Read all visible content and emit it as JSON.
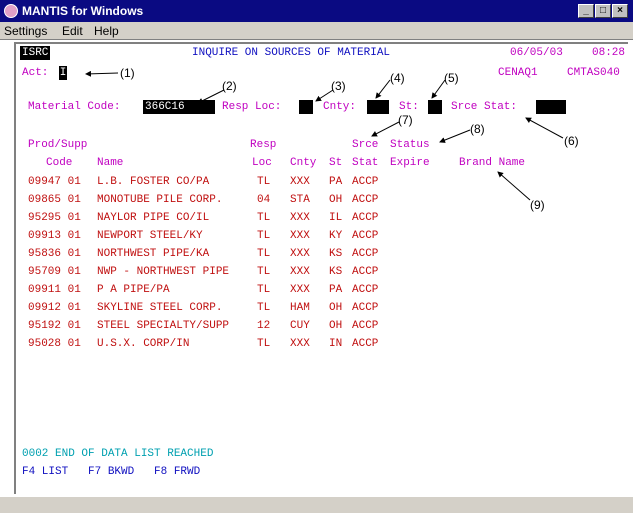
{
  "window": {
    "title": "MANTIS for Windows"
  },
  "menu": {
    "items": [
      "Settings",
      "Edit",
      "Help"
    ]
  },
  "header": {
    "screen_id": "ISRC",
    "title": "INQUIRE ON SOURCES OF MATERIAL",
    "date": "06/05/03",
    "time": "08:28",
    "user_id": "CENAQ1",
    "system_id": "CMTAS040"
  },
  "act": {
    "label": "Act:",
    "value": "I"
  },
  "form": {
    "material_code_label": "Material Code:",
    "material_code_value": "366C16",
    "resp_loc_label": "Resp Loc:",
    "cnty_label": "Cnty:",
    "st_label": "St:",
    "srce_stat_label": "Srce Stat:"
  },
  "columns": {
    "row1": {
      "prod_supp": "Prod/Supp",
      "resp": "Resp",
      "srce": "Srce",
      "status": "Status"
    },
    "row2": {
      "code": "Code",
      "name": "Name",
      "loc": "Loc",
      "cnty": "Cnty",
      "st": "St",
      "stat": "Stat",
      "expire": "Expire",
      "brand": "Brand Name"
    }
  },
  "rows": [
    {
      "code": "09947 01",
      "name": "L.B. FOSTER CO/PA",
      "loc": "TL",
      "cnty": "XXX",
      "st": "PA",
      "stat": "ACCP"
    },
    {
      "code": "09865 01",
      "name": "MONOTUBE PILE CORP.",
      "loc": "04",
      "cnty": "STA",
      "st": "OH",
      "stat": "ACCP"
    },
    {
      "code": "95295 01",
      "name": "NAYLOR PIPE CO/IL",
      "loc": "TL",
      "cnty": "XXX",
      "st": "IL",
      "stat": "ACCP"
    },
    {
      "code": "09913 01",
      "name": "NEWPORT STEEL/KY",
      "loc": "TL",
      "cnty": "XXX",
      "st": "KY",
      "stat": "ACCP"
    },
    {
      "code": "95836 01",
      "name": "NORTHWEST PIPE/KA",
      "loc": "TL",
      "cnty": "XXX",
      "st": "KS",
      "stat": "ACCP"
    },
    {
      "code": "95709 01",
      "name": "NWP - NORTHWEST PIPE",
      "loc": "TL",
      "cnty": "XXX",
      "st": "KS",
      "stat": "ACCP"
    },
    {
      "code": "09911 01",
      "name": "P A PIPE/PA",
      "loc": "TL",
      "cnty": "XXX",
      "st": "PA",
      "stat": "ACCP"
    },
    {
      "code": "09912 01",
      "name": "SKYLINE STEEL CORP.",
      "loc": "TL",
      "cnty": "HAM",
      "st": "OH",
      "stat": "ACCP"
    },
    {
      "code": "95192 01",
      "name": "STEEL SPECIALTY/SUPP",
      "loc": "12",
      "cnty": "CUY",
      "st": "OH",
      "stat": "ACCP"
    },
    {
      "code": "95028 01",
      "name": "U.S.X. CORP/IN",
      "loc": "TL",
      "cnty": "XXX",
      "st": "IN",
      "stat": "ACCP"
    }
  ],
  "message": "0002 END OF DATA LIST REACHED",
  "function_keys": "F4 LIST   F7 BKWD   F8 FRWD",
  "annotations": [
    "(1)",
    "(2)",
    "(3)",
    "(4)",
    "(5)",
    "(6)",
    "(7)",
    "(8)",
    "(9)"
  ],
  "colors": {
    "titlebar": "#0a0a82",
    "label": "#c000c0",
    "title": "#1010c0",
    "data": "#c01010",
    "message": "#00a0b0"
  }
}
